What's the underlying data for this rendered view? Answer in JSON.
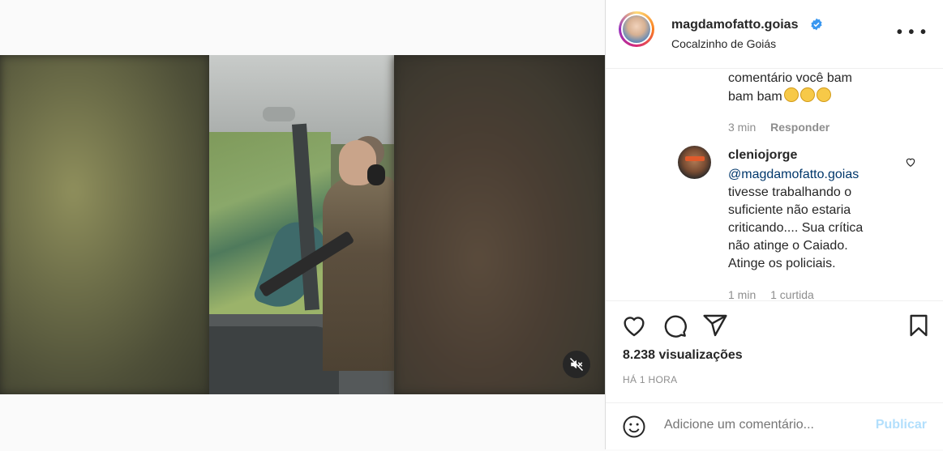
{
  "post": {
    "username": "magdamofatto.goias",
    "location": "Cocalzinho de Goiás",
    "more_icon": "ellipsis-icon",
    "verified_color": "#3897f0"
  },
  "comments": [
    {
      "text_line1": "comentário você bam",
      "text_line2": "bam bam",
      "time": "3 min",
      "reply": "Responder"
    },
    {
      "username": "cleniojorge",
      "mention": "@magdamofatto.goias",
      "lines": [
        "tivesse trabalhando o",
        "suficiente não estaria",
        "criticando.... Sua crítica",
        "não atinge o Caiado.",
        "Atinge os policiais."
      ],
      "time": "1 min",
      "likes": "1 curtida"
    }
  ],
  "stats": {
    "views": "8.238 visualizações",
    "time_ago": "HÁ 1 HORA"
  },
  "comment_box": {
    "placeholder": "Adicione um comentário...",
    "post_label": "Publicar"
  },
  "colors": {
    "link": "#00376b",
    "muted": "#8e8e8e",
    "post_disabled": "#b2dffc"
  }
}
